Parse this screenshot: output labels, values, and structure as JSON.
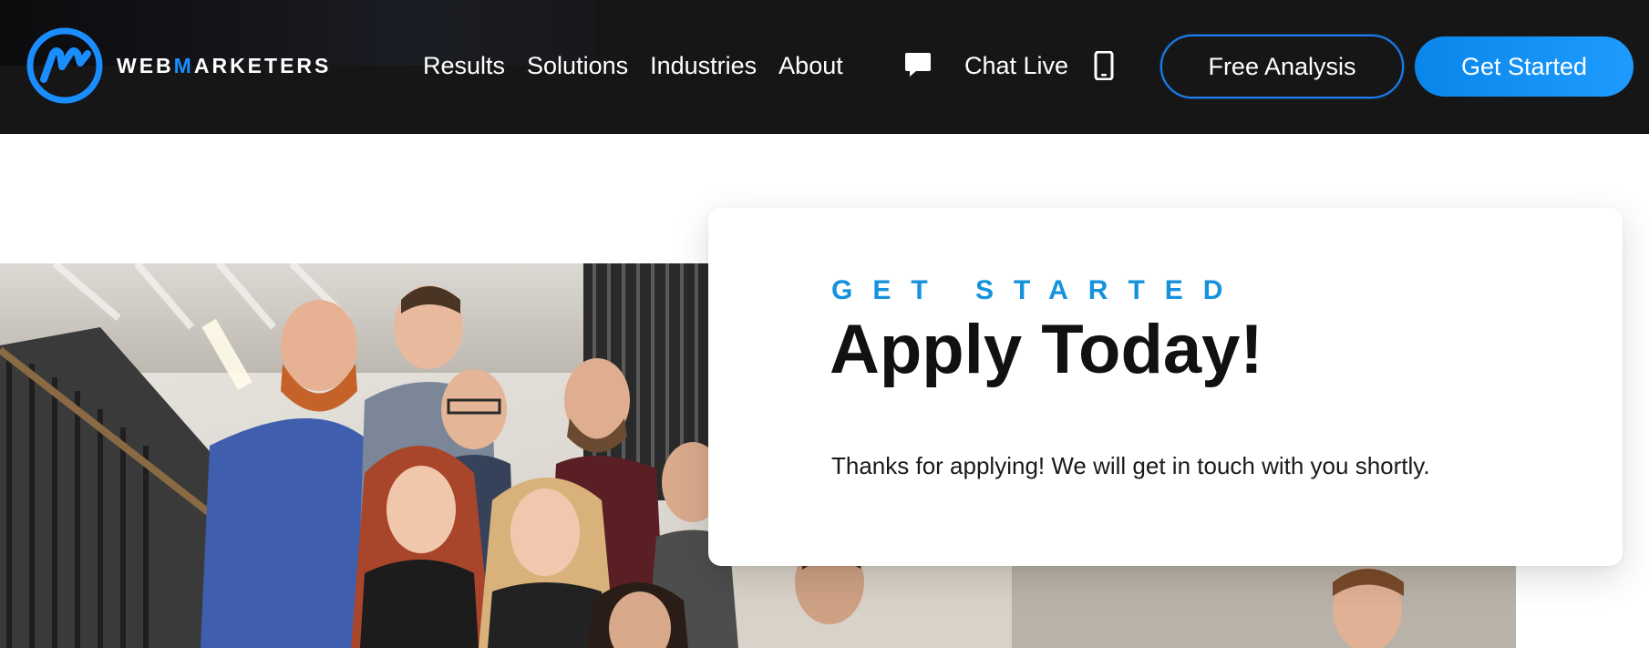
{
  "header": {
    "logo": {
      "text_prefix": "WEB",
      "text_accent": "M",
      "text_suffix": "ARKETERS",
      "icon": "wm-logo-icon"
    },
    "nav": [
      {
        "label": "Results"
      },
      {
        "label": "Solutions"
      },
      {
        "label": "Industries"
      },
      {
        "label": "About"
      }
    ],
    "chat_icon": "chat-bubble-icon",
    "chat_live_label": "Chat Live",
    "phone_icon": "mobile-phone-icon",
    "free_analysis_label": "Free Analysis",
    "get_started_label": "Get Started"
  },
  "card": {
    "eyebrow": "GET STARTED",
    "heading": "Apply Today!",
    "message": "Thanks for applying! We will get in touch with you shortly."
  },
  "colors": {
    "header_bg": "#161616",
    "accent_blue": "#1a8dff",
    "eyebrow_blue": "#1592dd",
    "heading": "#111111"
  },
  "hero_photo": {
    "description_icon": "team-photo"
  }
}
